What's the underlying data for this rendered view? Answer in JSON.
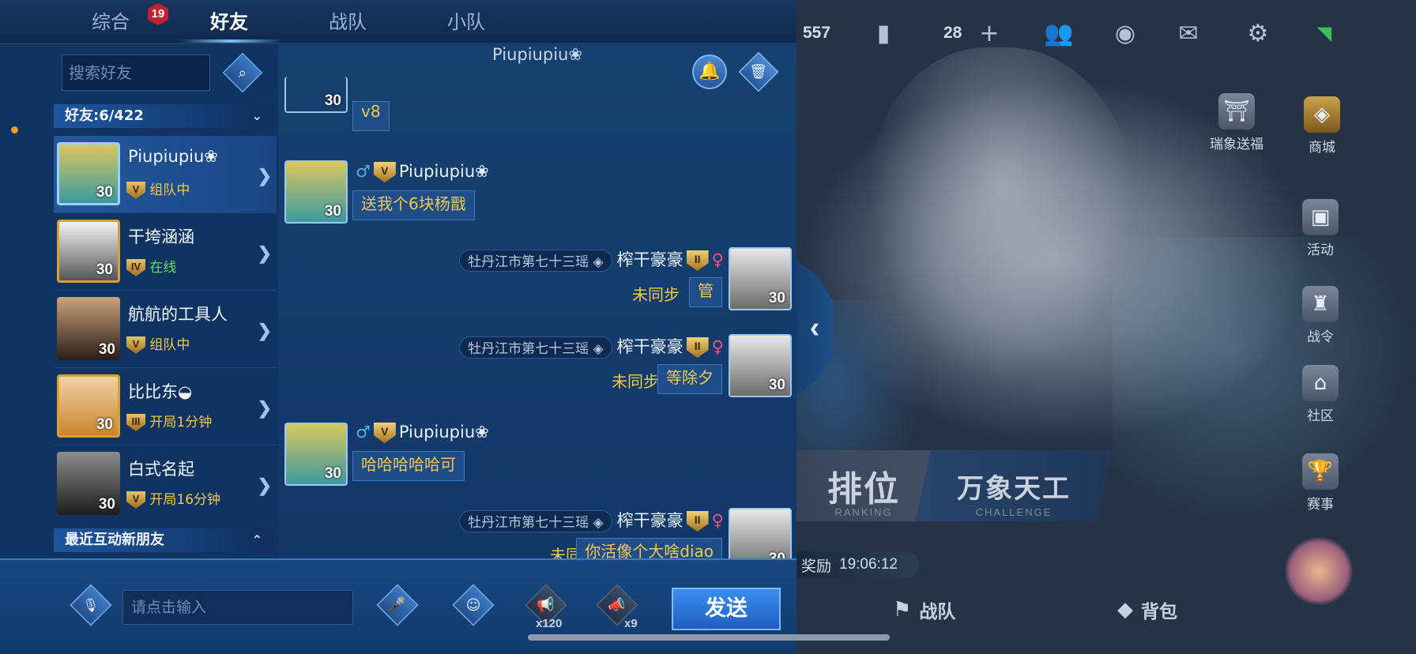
{
  "tabs": [
    {
      "label": "综合",
      "badge": "19"
    },
    {
      "label": "好友"
    },
    {
      "label": "战队"
    },
    {
      "label": "小队"
    }
  ],
  "friends": {
    "search_placeholder": "搜索好友",
    "group_label": "好友:6/422",
    "recent_group_label": "最近互动新朋友",
    "items": [
      {
        "name": "Piupiupiu❀",
        "level": "30",
        "status": "组队中",
        "status_color": "#f2c94c",
        "vip": "V"
      },
      {
        "name": "干垮涵涵",
        "level": "30",
        "status": "在线",
        "status_color": "#5fe05a",
        "vip": "IV"
      },
      {
        "name": "航航的工具人",
        "level": "30",
        "status": "组队中",
        "status_color": "#f2c94c",
        "vip": "V"
      },
      {
        "name": "比比东◒",
        "level": "30",
        "status": "开局1分钟",
        "status_color": "#f2c94c",
        "vip": "III"
      },
      {
        "name": "白式名起",
        "level": "30",
        "status": "开局16分钟",
        "status_color": "#f2c94c",
        "vip": "V"
      }
    ]
  },
  "chat": {
    "title": "Piupiupiu❀",
    "messages": [
      {
        "side": "left",
        "level": "30",
        "text": "v8"
      },
      {
        "side": "left",
        "level": "30",
        "sender": "Piupiupiu❀",
        "vip": "V",
        "text": "送我个6块杨戬"
      },
      {
        "side": "right",
        "level": "30",
        "guild": "牡丹江市第七十三瑶",
        "sender": "榨干豪豪",
        "vip": "II",
        "sync": "未同步",
        "text": "管"
      },
      {
        "side": "right",
        "level": "30",
        "guild": "牡丹江市第七十三瑶",
        "sender": "榨干豪豪",
        "vip": "II",
        "sync": "未同步",
        "text": "等除夕"
      },
      {
        "side": "left",
        "level": "30",
        "sender": "Piupiupiu❀",
        "vip": "V",
        "text": "哈哈哈哈哈可"
      },
      {
        "side": "right",
        "level": "30",
        "guild": "牡丹江市第七十三瑶",
        "sender": "榨干豪豪",
        "vip": "II",
        "sync": "未同步",
        "text": "你活像个大啥diao"
      }
    ]
  },
  "input": {
    "placeholder": "请点击输入",
    "horn_small_count": "x120",
    "horn_big_count": "x9",
    "send_label": "发送"
  },
  "background": {
    "currency": "557",
    "tickets": "28",
    "side_buttons": [
      "瑞象送福",
      "商城",
      "活动",
      "战令",
      "社区",
      "赛事"
    ],
    "modes": [
      {
        "label": "排位",
        "sub": "RANKING"
      },
      {
        "label": "万象天工",
        "sub": "CHALLENGE"
      }
    ],
    "timer_prefix": "奖励",
    "timer": "19:06:12",
    "bottom_nav": [
      "战队",
      "背包"
    ]
  }
}
